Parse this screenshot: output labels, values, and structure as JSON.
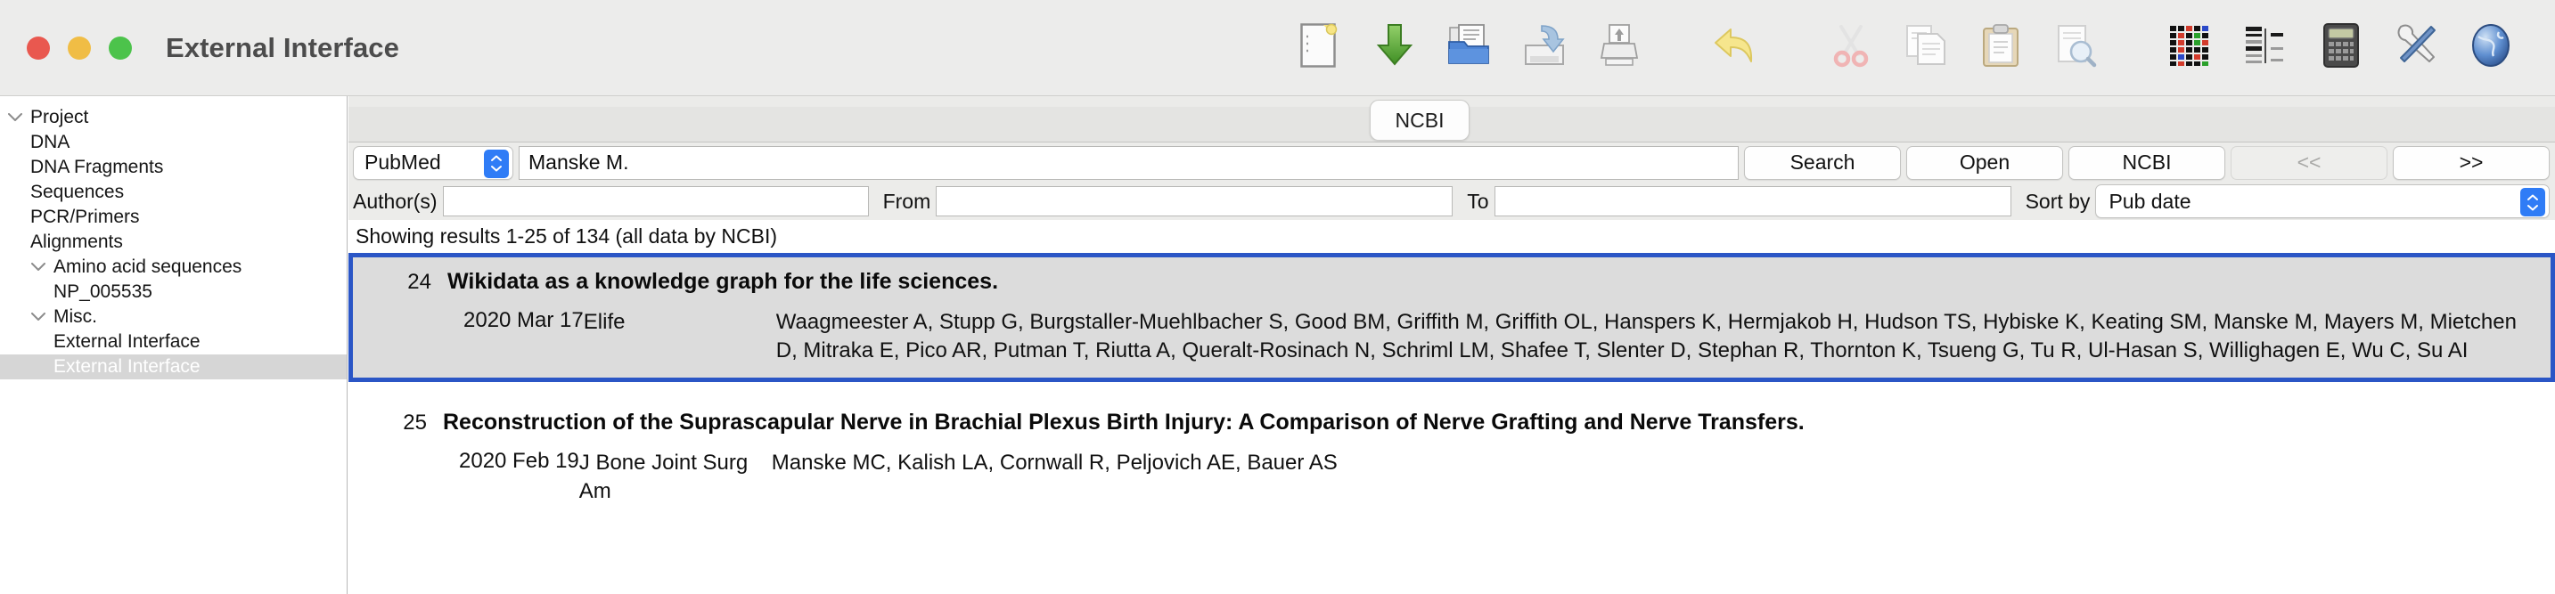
{
  "window": {
    "title": "External Interface",
    "traffic_lights": [
      "close",
      "minimize",
      "zoom"
    ]
  },
  "toolbar": {
    "items": [
      {
        "name": "new-document-icon",
        "label": "New"
      },
      {
        "name": "download-icon",
        "label": "Download"
      },
      {
        "name": "open-folder-icon",
        "label": "Open"
      },
      {
        "name": "save-icon",
        "label": "Save"
      },
      {
        "name": "print-icon",
        "label": "Print"
      },
      {
        "name": "undo-icon",
        "label": "Undo"
      },
      {
        "name": "cut-scissors-icon",
        "label": "Cut"
      },
      {
        "name": "copy-icon",
        "label": "Copy"
      },
      {
        "name": "paste-clipboard-icon",
        "label": "Paste"
      },
      {
        "name": "find-document-icon",
        "label": "Find"
      },
      {
        "name": "sequence-grid-icon",
        "label": "Sequence grid"
      },
      {
        "name": "gel-lanes-icon",
        "label": "Gel"
      },
      {
        "name": "calculator-icon",
        "label": "Calculator"
      },
      {
        "name": "tools-icon",
        "label": "Tools"
      },
      {
        "name": "globe-icon",
        "label": "Internet"
      }
    ]
  },
  "sidebar": {
    "items": [
      {
        "label": "Project",
        "level": 0,
        "twisty": "down",
        "selected": false
      },
      {
        "label": "DNA",
        "level": 1,
        "twisty": "none",
        "selected": false
      },
      {
        "label": "DNA Fragments",
        "level": 1,
        "twisty": "none",
        "selected": false
      },
      {
        "label": "Sequences",
        "level": 1,
        "twisty": "none",
        "selected": false
      },
      {
        "label": "PCR/Primers",
        "level": 1,
        "twisty": "none",
        "selected": false
      },
      {
        "label": "Alignments",
        "level": 1,
        "twisty": "none",
        "selected": false
      },
      {
        "label": "Amino acid sequences",
        "level": 1,
        "twisty": "down",
        "selected": false
      },
      {
        "label": "NP_005535",
        "level": 2,
        "twisty": "none",
        "selected": false
      },
      {
        "label": "Misc.",
        "level": 1,
        "twisty": "down",
        "selected": false
      },
      {
        "label": "External Interface",
        "level": 2,
        "twisty": "none",
        "selected": false
      },
      {
        "label": "External Interface",
        "level": 2,
        "twisty": "none",
        "selected": true
      }
    ]
  },
  "main": {
    "tab": {
      "label": "NCBI"
    },
    "search": {
      "database_value": "PubMed",
      "query_value": "Manske M.",
      "query_placeholder": "",
      "buttons": [
        {
          "label": "Search",
          "name": "search-button",
          "disabled": false
        },
        {
          "label": "Open",
          "name": "open-button",
          "disabled": false
        },
        {
          "label": "NCBI",
          "name": "ncbi-button",
          "disabled": false
        },
        {
          "label": "<<",
          "name": "prev-page-button",
          "disabled": true
        },
        {
          "label": ">>",
          "name": "next-page-button",
          "disabled": false
        }
      ]
    },
    "filters": {
      "authors_label": "Author(s)",
      "authors_value": "",
      "from_label": "From",
      "from_value": "",
      "to_label": "To",
      "to_value": "",
      "sort_label": "Sort by",
      "sort_value": "Pub date"
    },
    "status": "Showing results 1-25 of 134 (all data by NCBI)",
    "results": [
      {
        "number": "24",
        "title": "Wikidata as a knowledge graph for the life sciences.",
        "date": "2020 Mar 17",
        "journal": "Elife",
        "authors": "Waagmeester A, Stupp G, Burgstaller-Muehlbacher S, Good BM, Griffith M, Griffith OL, Hanspers K, Hermjakob H, Hudson TS, Hybiske K, Keating SM, Manske M, Mayers M, Mietchen D, Mitraka E, Pico AR, Putman T, Riutta A, Queralt-Rosinach N, Schriml LM, Shafee T, Slenter D, Stephan R, Thornton K, Tsueng G, Tu R, Ul-Hasan S, Willighagen E, Wu C, Su AI",
        "selected": true
      },
      {
        "number": "25",
        "title": "Reconstruction of the Suprascapular Nerve in Brachial Plexus Birth Injury: A Comparison of Nerve Grafting and Nerve Transfers.",
        "date": "2020 Feb 19",
        "journal": "J Bone Joint Surg Am",
        "authors": "Manske MC, Kalish LA, Cornwall R, Peljovich AE, Bauer AS",
        "selected": false
      }
    ]
  },
  "colors": {
    "selection_border": "#2b56c6",
    "selection_background": "#dcdcdc",
    "accent_blue": "#2f7cf6",
    "titlebar": "#ececeb",
    "traffic_red": "#e9584f",
    "traffic_yellow": "#f0bd45",
    "traffic_green": "#4cc34b"
  }
}
